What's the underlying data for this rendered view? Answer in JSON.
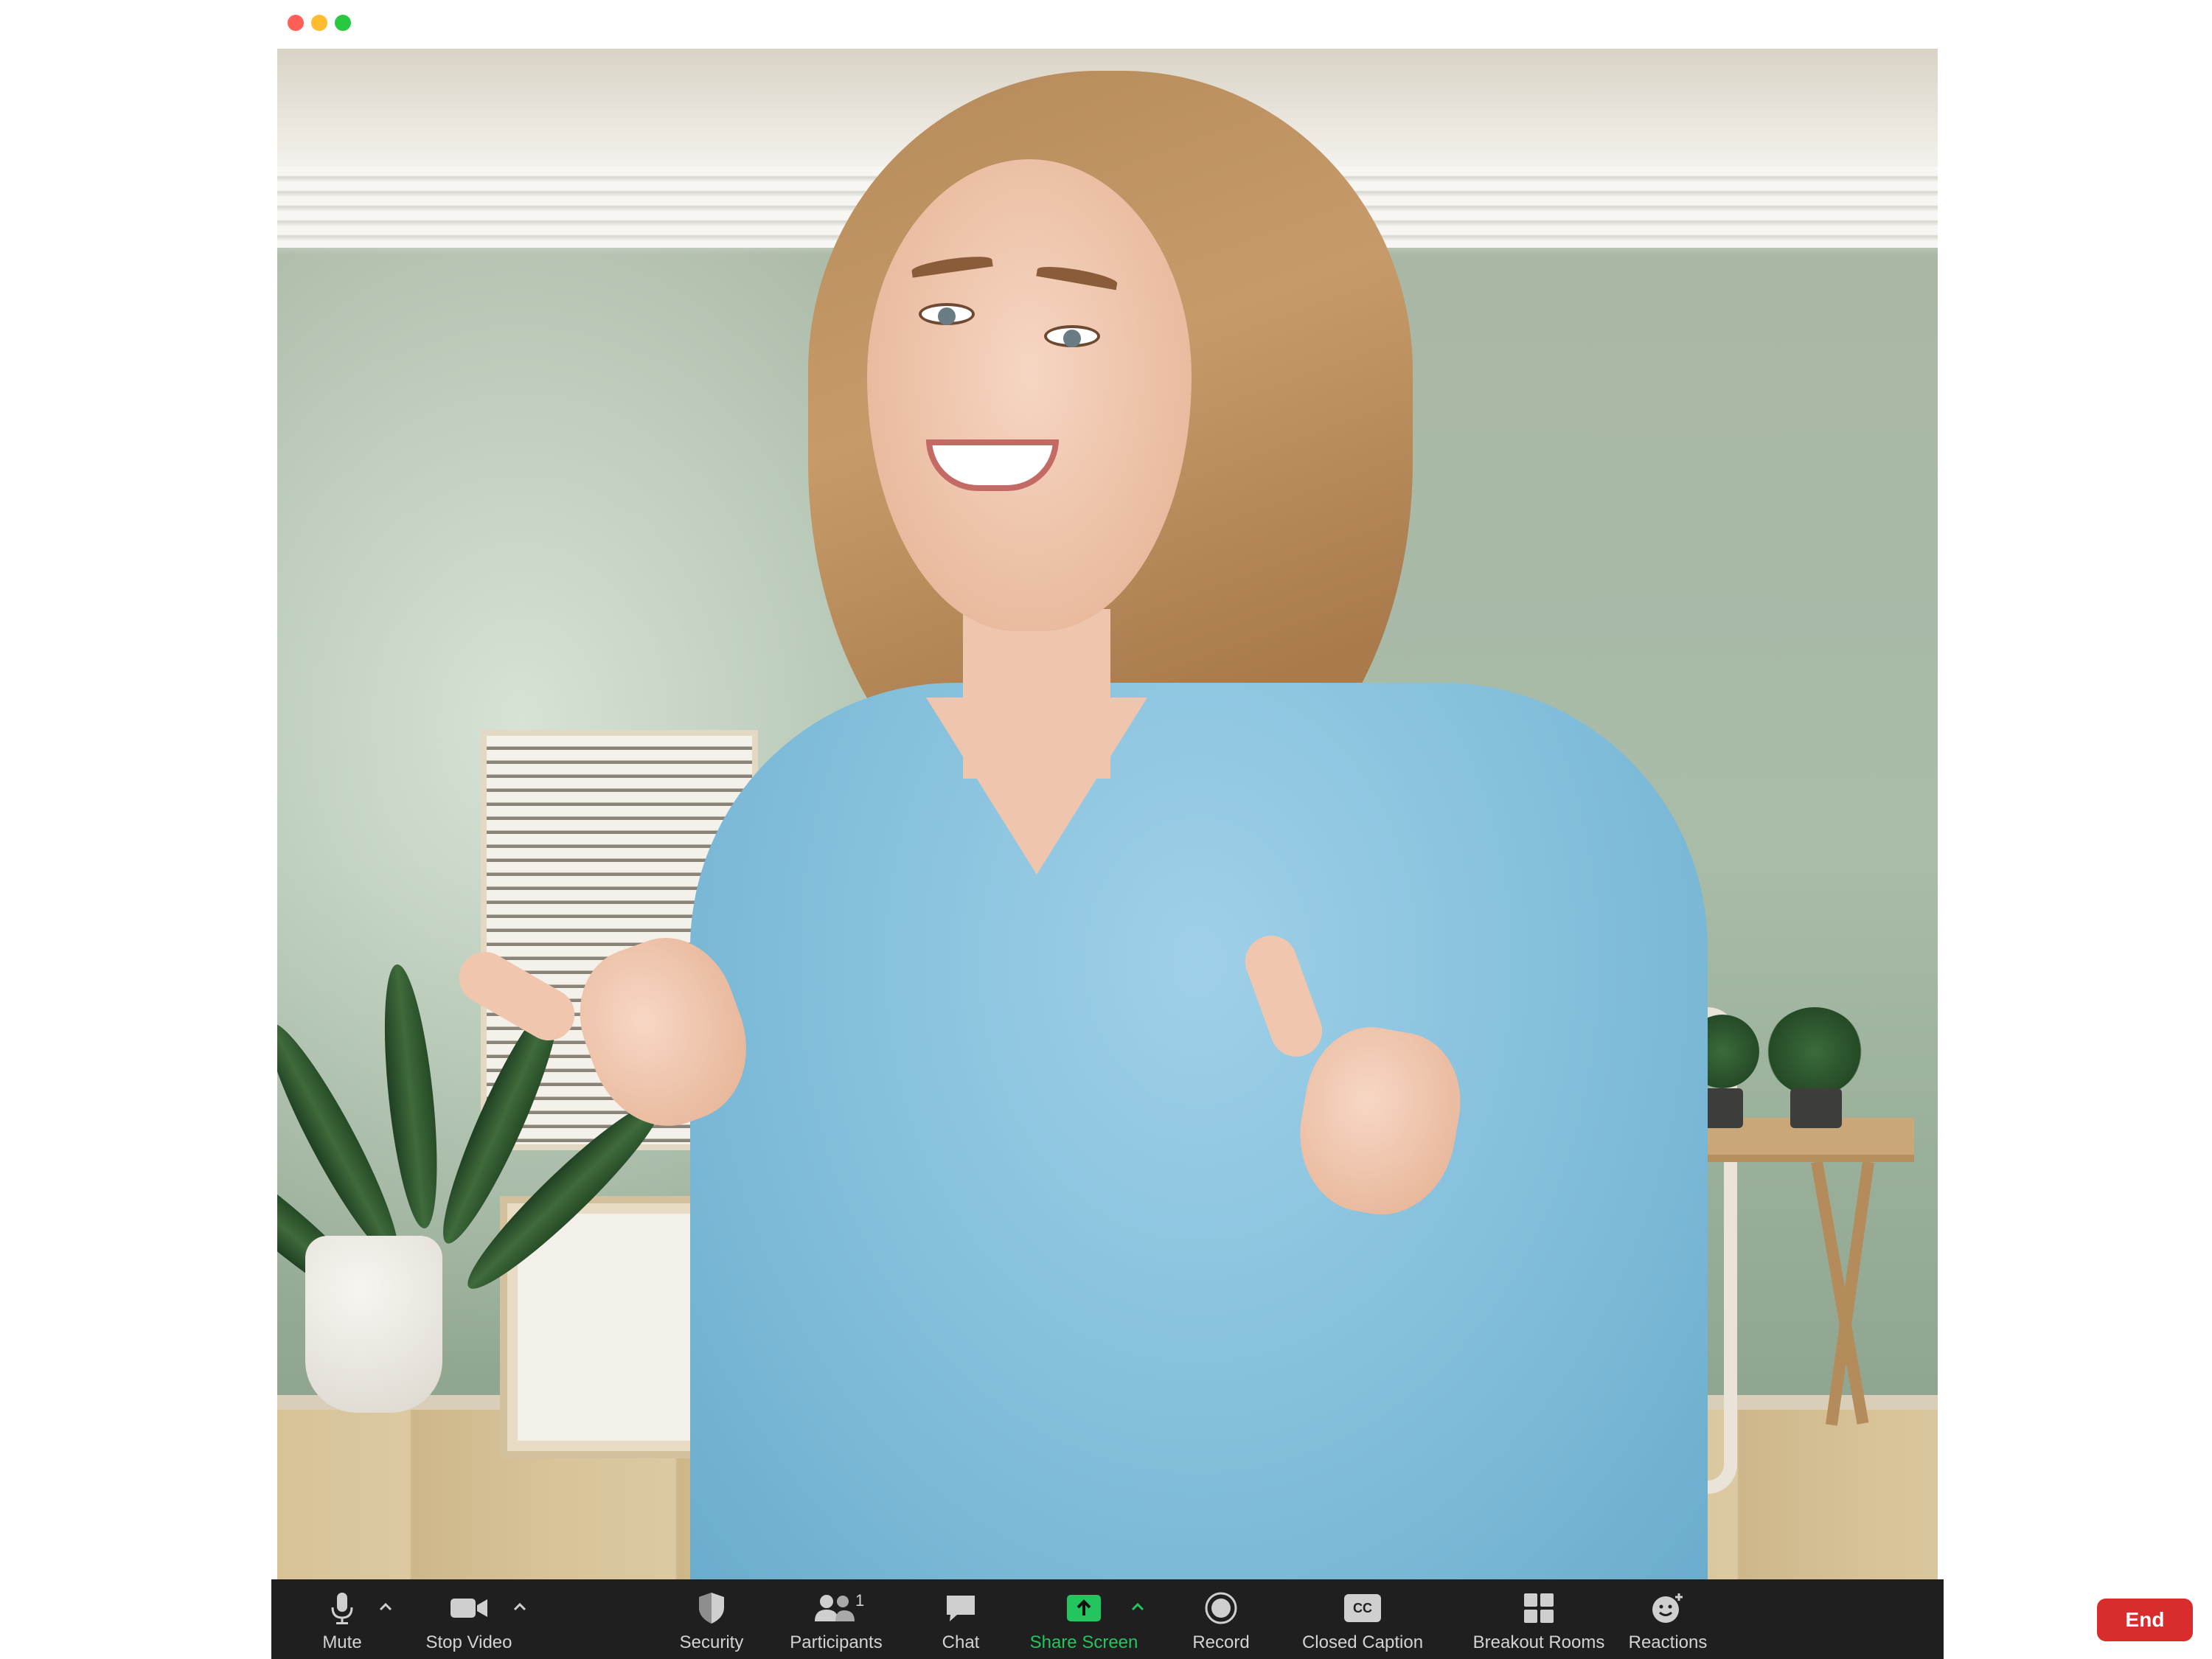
{
  "window": {
    "controls": [
      "close",
      "minimize",
      "zoom"
    ]
  },
  "video": {
    "participant_feed": "smiling-woman-in-light-blue-sweater"
  },
  "toolbar": {
    "items": [
      {
        "label": "Mute",
        "icon": "microphone-icon",
        "has_caret": true
      },
      {
        "label": "Stop Video",
        "icon": "video-camera-icon",
        "has_caret": true
      },
      {
        "label": "Security",
        "icon": "shield-icon",
        "has_caret": false
      },
      {
        "label": "Participants",
        "icon": "participants-icon",
        "badge": "1",
        "has_caret": false
      },
      {
        "label": "Chat",
        "icon": "chat-bubble-icon",
        "has_caret": false
      },
      {
        "label": "Share Screen",
        "icon": "share-screen-icon",
        "has_caret": true,
        "color": "#22c55e"
      },
      {
        "label": "Record",
        "icon": "record-icon",
        "has_caret": false
      },
      {
        "label": "Closed Caption",
        "icon": "closed-caption-icon",
        "icon_text": "CC",
        "has_caret": false
      },
      {
        "label": "Breakout Rooms",
        "icon": "breakout-rooms-icon",
        "has_caret": false
      },
      {
        "label": "Reactions",
        "icon": "reactions-icon",
        "has_caret": false
      }
    ],
    "end_label": "End",
    "end_color": "#d92d2d"
  }
}
